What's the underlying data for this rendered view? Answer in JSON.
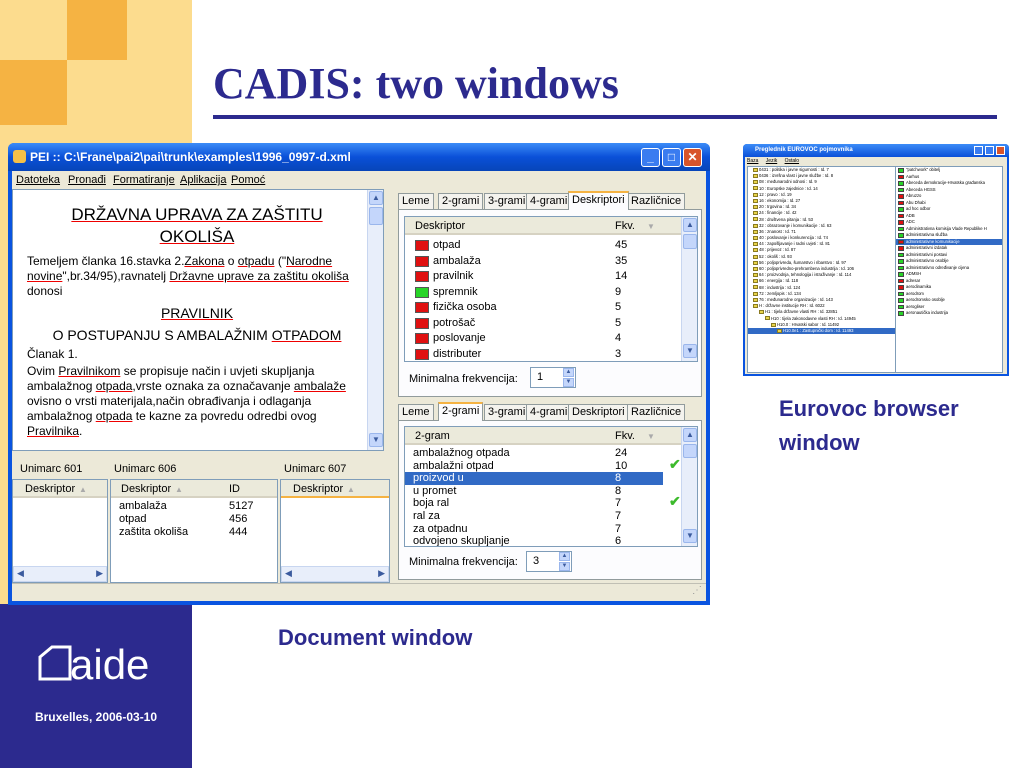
{
  "slide": {
    "title": "CADIS: two windows",
    "caption_eurovoc_line1": "Eurovoc browser",
    "caption_eurovoc_line2": "window",
    "caption_document": "Document window",
    "logo_text": "aide",
    "footer_date": "Bruxelles, 2006-03-10",
    "colors": {
      "accent_blue": "#2c2a8e",
      "accent_orange": "#f5b343",
      "accent_yellow": "#fcdc8e"
    }
  },
  "pei_window": {
    "title": "PEI :: C:\\Frane\\pai2\\pai\\trunk\\examples\\1996_0997-d.xml",
    "menu": [
      "Datoteka",
      "Pronađi",
      "Formatiranje",
      "Aplikacija",
      "Pomoć"
    ],
    "document": {
      "heading_line1": "DRŽAVNA UPRAVA ZA ZAŠTITU",
      "heading_line2": "OKOLIŠA",
      "para1_a": "Temeljem članka 16.stavka 2.",
      "para1_link1": "Zakona",
      "para1_b": " o ",
      "para1_link2": "otpadu",
      "para1_c": " (\"",
      "para1_link3": "Narodne novine",
      "para1_d": "\",br.34/95),ravnatelj ",
      "para1_link4": "Državne uprave za zaštitu okoliša",
      "para1_e": " donosi",
      "subheading1": "PRAVILNIK",
      "subheading2_a": "O POSTUPANJU S AMBALAŽNIM ",
      "subheading2_link": "OTPADOM",
      "clanak": "Članak 1.",
      "para2_a": "Ovim ",
      "para2_link1": "Pravilnikom",
      "para2_b": " se propisuje način i uvjeti skupljanja ambalažnog ",
      "para2_link2": "otpada",
      "para2_c": ",vrste oznaka za označavanje ",
      "para2_link3": "ambalaže",
      "para2_d": " ovisno o vrsti materijala,način obrađivanja i odlaganja ambalažnog ",
      "para2_link4": "otpada",
      "para2_e": " te kazne za povredu odredbi ovog ",
      "para2_link5": "Pravilnika",
      "para2_f": "."
    },
    "top_tabs": [
      "Leme",
      "2-grami",
      "3-grami",
      "4-grami",
      "Deskriptori",
      "Razlicnice"
    ],
    "top_tabs_display": [
      "Leme",
      "2-grami",
      "3-grami",
      "4-grami",
      "Deskriptori",
      "Različnice"
    ],
    "top_active_tab": "Deskriptori",
    "descriptors_table": {
      "col1": "Deskriptor",
      "col2": "Fkv.",
      "rows": [
        {
          "label": "otpad",
          "value": "45",
          "color": "#e01010"
        },
        {
          "label": "ambalaža",
          "value": "35",
          "color": "#e01010"
        },
        {
          "label": "pravilnik",
          "value": "14",
          "color": "#e01010"
        },
        {
          "label": "spremnik",
          "value": "9",
          "color": "#28d428"
        },
        {
          "label": "fizička osoba",
          "value": "5",
          "color": "#e01010"
        },
        {
          "label": "potrošač",
          "value": "5",
          "color": "#e01010"
        },
        {
          "label": "poslovanje",
          "value": "4",
          "color": "#e01010"
        },
        {
          "label": "distributer",
          "value": "3",
          "color": "#e01010"
        }
      ]
    },
    "min_freq_label": "Minimalna frekvencija:",
    "min_freq_top": "1",
    "bottom_tabs": [
      "Leme",
      "2-grami",
      "3-grami",
      "4-grami",
      "Deskriptori",
      "Različnice"
    ],
    "bottom_active_tab": "2-grami",
    "ngram_table": {
      "col1": "2-gram",
      "col2": "Fkv.",
      "rows": [
        {
          "label": "ambalažnog otpada",
          "value": "24",
          "check": false,
          "selected": false
        },
        {
          "label": "ambalažni otpad",
          "value": "10",
          "check": true,
          "selected": false
        },
        {
          "label": "proizvod u",
          "value": "8",
          "check": false,
          "selected": true
        },
        {
          "label": "u promet",
          "value": "8",
          "check": false,
          "selected": false
        },
        {
          "label": "boja ral",
          "value": "7",
          "check": true,
          "selected": false
        },
        {
          "label": "ral za",
          "value": "7",
          "check": false,
          "selected": false
        },
        {
          "label": "za otpadnu",
          "value": "7",
          "check": false,
          "selected": false
        },
        {
          "label": "odvojeno skupljanje",
          "value": "6",
          "check": false,
          "selected": false
        }
      ]
    },
    "min_freq_bottom": "3",
    "unimarc": {
      "col601": "Unimarc 601",
      "col606": "Unimarc 606",
      "col607": "Unimarc 607",
      "deskriptor": "Deskriptor",
      "id": "ID",
      "rows606": [
        {
          "label": "ambalaža",
          "id": "5127"
        },
        {
          "label": "otpad",
          "id": "456"
        },
        {
          "label": "zaštita okoliša",
          "id": "444"
        }
      ]
    }
  },
  "eurovoc_window": {
    "title": "Preglednik EUROVOC pojmovnika",
    "menu": [
      "Baza",
      "Jezik",
      "Ostalo"
    ],
    "tree": [
      "0431 : politika i javne sigurnosti : Id. 7",
      "0436 : izvršna vlast i javne službe : Id. 8",
      "08 : međunarodni odnosi : Id. 9",
      "10 : Europske zajednice : Id. 14",
      "12 : pravo : Id. 19",
      "16 : ekonomija : Id. 27",
      "20 : trgovina : Id. 34",
      "24 : financije : Id. 42",
      "28 : društvena pitanja : Id. 53",
      "32 : obrazovanje i komunikacije : Id. 63",
      "36 : znanost : Id. 71",
      "40 : poslovanje i konkurencija : Id. 74",
      "44 : zapošljavanje i radni uvjeti : Id. 81",
      "48 : prijevoz : Id. 87",
      "52 : okoliš : Id. 93",
      "56 : poljoprivreda, šumarstvo i ribarstvo : Id. 97",
      "60 : poljoprivredno-prehrambena industrija : Id. 106",
      "64 : proizvodnja, tehnologija i istraživanje : Id. 114",
      "66 : energija : Id. 118",
      "68 : industrija : Id. 124",
      "72 : zemljopis : Id. 134",
      "76 : međunarodne organizacije : Id. 143",
      "H : državne institucije RH : Id. 6022",
      "H1 : tijela državne vlasti RH : Id. 32851",
      "H10 : tijela zakonodavne vlasti RH : Id. 14945",
      "H10.0 : Hrvatski sabor : Id. 11492",
      "H10.0e1 : Zastupnički dom : Id. 11493"
    ],
    "list": [
      {
        "label": "\"patchwork\" obitelj",
        "color": "#28d428"
      },
      {
        "label": "Aarhus",
        "color": "#e01010"
      },
      {
        "label": "Abeceda demokracije-Hrvatska građanska",
        "color": "#28d428"
      },
      {
        "label": "Abeceda HGSS",
        "color": "#28d428"
      },
      {
        "label": "Abruzzo",
        "color": "#e01010"
      },
      {
        "label": "Abu Dhabi",
        "color": "#e01010"
      },
      {
        "label": "ad hoc odbor",
        "color": "#28d428"
      },
      {
        "label": "ADB",
        "color": "#e01010"
      },
      {
        "label": "ADC",
        "color": "#e01010"
      },
      {
        "label": "Administrativna komisija Vlade Republike H",
        "color": "#28d428"
      },
      {
        "label": "administrativna služba",
        "color": "#28d428"
      },
      {
        "label": "administrativne komunikacije",
        "color": "#e01010"
      },
      {
        "label": "administrativni izdatak",
        "color": "#e01010"
      },
      {
        "label": "administrativni postavi",
        "color": "#28d428"
      },
      {
        "label": "administrativno osoblje",
        "color": "#28d428"
      },
      {
        "label": "administrativno određivanje cijena",
        "color": "#28d428"
      },
      {
        "label": "ADMSH",
        "color": "#28d428"
      },
      {
        "label": "adresar",
        "color": "#e01010"
      },
      {
        "label": "aerodinamika",
        "color": "#e01010"
      },
      {
        "label": "aerodrom",
        "color": "#28d428"
      },
      {
        "label": "aerodromsko osoblje",
        "color": "#28d428"
      },
      {
        "label": "aerogliser",
        "color": "#28d428"
      },
      {
        "label": "aeronautička industrija",
        "color": "#28d428"
      }
    ]
  }
}
